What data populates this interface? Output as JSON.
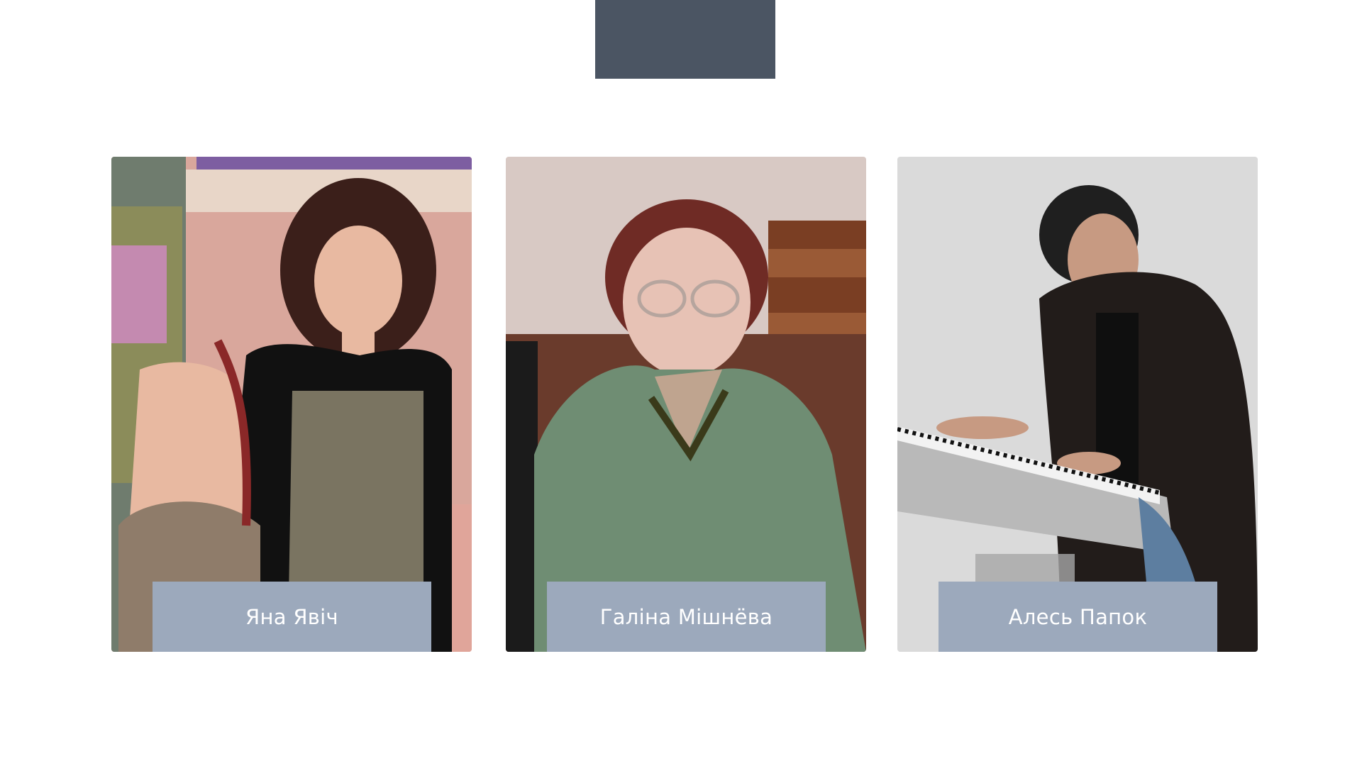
{
  "team": {
    "members": [
      {
        "name": "Яна Явіч",
        "photo_alt": "photo-woman-dark-hair"
      },
      {
        "name": "Галіна Мішнёва",
        "photo_alt": "photo-elderly-woman-glasses"
      },
      {
        "name": "Алесь Папок",
        "photo_alt": "photo-man-playing-keyboard"
      }
    ]
  },
  "colors": {
    "header_block": "#4b5563",
    "name_plate": "#9ca9bc",
    "name_text": "#ffffff",
    "background": "#ffffff"
  }
}
